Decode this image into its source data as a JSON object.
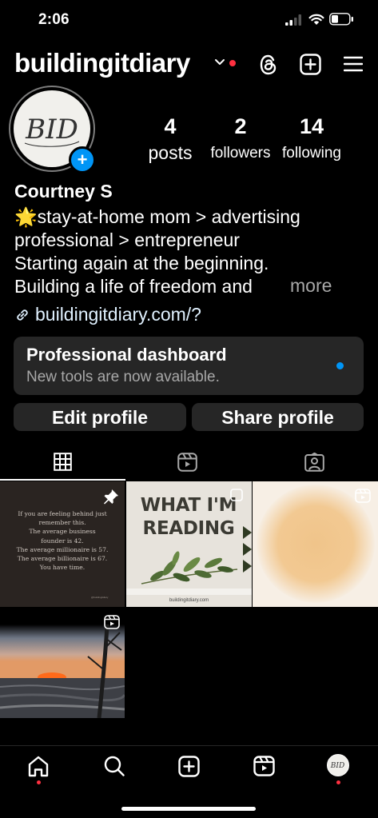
{
  "status_bar": {
    "time": "2:06"
  },
  "header": {
    "username": "buildingitdiary"
  },
  "profile": {
    "avatar_initials": "BID",
    "stats": [
      {
        "value": "4",
        "label": "posts"
      },
      {
        "value": "2",
        "label": "followers"
      },
      {
        "value": "14",
        "label": "following"
      }
    ],
    "name": "Courtney S",
    "bio_lines": [
      "🌟stay-at-home mom > advertising",
      "professional > entrepreneur",
      "Starting again at the beginning.",
      "Building a life of freedom and"
    ],
    "more_label": "more",
    "link": "buildingitdiary.com/?"
  },
  "dashboard": {
    "title": "Professional dashboard",
    "subtitle": "New tools are now available."
  },
  "buttons": {
    "edit": "Edit profile",
    "share": "Share profile"
  },
  "posts": {
    "post1_lines": [
      "If you are feeling behind just",
      "remember this.",
      "The average business",
      "founder is 42.",
      "The average millionaire is 57.",
      "The average billionaire is 67.",
      "You have time."
    ],
    "post1_footer": "@buildingitdiary",
    "post2_title_line1": "WHAT I'M",
    "post2_title_line2": "READING",
    "post2_url": "buildingitdiary.com"
  },
  "accent_colors": {
    "blue": "#0095f6",
    "red_dot": "#ff3040",
    "card_bg": "#262626"
  }
}
